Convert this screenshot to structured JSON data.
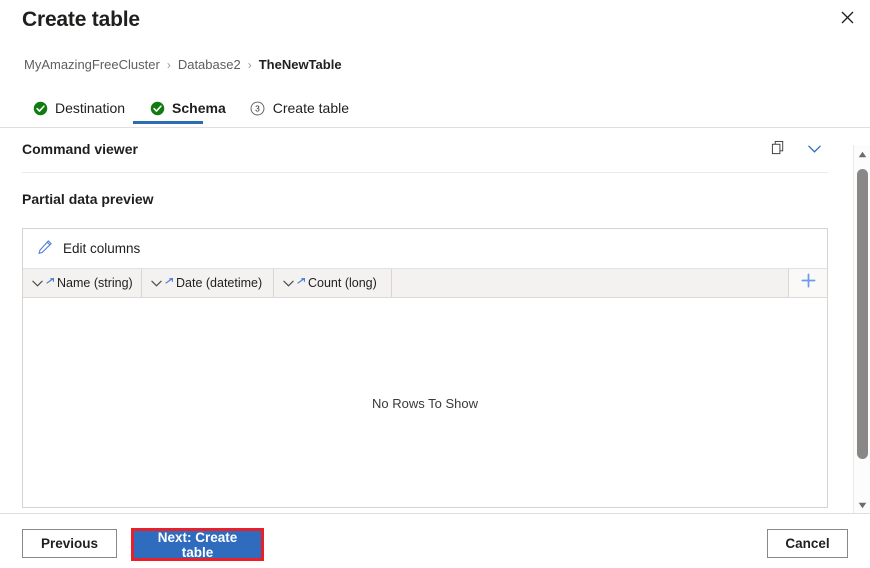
{
  "window": {
    "title": "Create table",
    "close_label": "×",
    "close_icon": "close-icon"
  },
  "breadcrumb": {
    "separator": "›",
    "items": [
      {
        "label": "MyAmazingFreeCluster",
        "current": false
      },
      {
        "label": "Database2",
        "current": false
      },
      {
        "label": "TheNewTable",
        "current": true
      }
    ]
  },
  "steps": [
    {
      "label": "Destination",
      "state": "complete",
      "marker": "check-circle-icon",
      "number": "1"
    },
    {
      "label": "Schema",
      "state": "active-complete",
      "marker": "check-circle-icon",
      "number": "2"
    },
    {
      "label": "Create table",
      "state": "upcoming",
      "marker": "numbered-circle-icon",
      "number": "3"
    }
  ],
  "command_viewer": {
    "title": "Command viewer",
    "copy_icon": "copy-icon",
    "expand_icon": "chevron-down-icon"
  },
  "main": {
    "section_label": "Partial data preview",
    "grid": {
      "edit_columns_label": "Edit columns",
      "edit_columns_icon": "pencil-icon",
      "add_column_icon": "plus-icon",
      "columns": [
        {
          "label": "Name (string)",
          "name": "Name",
          "type": "string"
        },
        {
          "label": "Date (datetime)",
          "name": "Date",
          "type": "datetime"
        },
        {
          "label": "Count (long)",
          "name": "Count",
          "type": "long"
        }
      ],
      "rows": [],
      "empty_message": "No Rows To Show"
    }
  },
  "scrollbar": {
    "up_icon": "scroll-up-arrow-icon",
    "down_icon": "scroll-down-arrow-icon"
  },
  "footer": {
    "previous_label": "Previous",
    "next_label": "Next: Create table",
    "cancel_label": "Cancel"
  },
  "colors": {
    "accent_blue": "#2f6cbd",
    "tab_underline": "#2b6cb5",
    "success_green": "#107c10",
    "annotation_red": "#e8202a",
    "icon_blue": "#4f7fd4",
    "text_primary": "#201f1e",
    "text_secondary": "#605e5c"
  }
}
